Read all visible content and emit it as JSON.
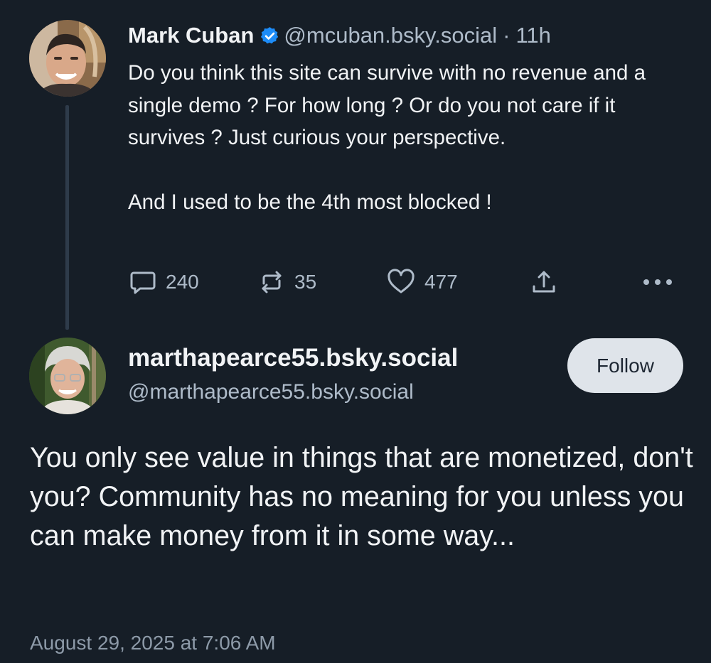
{
  "parent_post": {
    "author_name": "Mark Cuban",
    "verified": true,
    "handle": "@mcuban.bsky.social",
    "separator": "·",
    "time": "11h",
    "text_paragraphs": [
      "Do you think this site can survive with no revenue and a single demo ? For how long ? Or do you not care if it survives ? Just curious your perspective.",
      "And I used to be the 4th most blocked !"
    ],
    "actions": {
      "reply_count": "240",
      "repost_count": "35",
      "like_count": "477"
    }
  },
  "reply_post": {
    "display_name": "marthapearce55.bsky.social",
    "handle": "@marthapearce55.bsky.social",
    "follow_label": "Follow",
    "text": "You only see value in things that are monetized, don't you? Community has no meaning for you unless you can make money from it in some way...",
    "timestamp": "August 29, 2025 at 7:06 AM"
  },
  "icons": {
    "verified": "verified-badge-icon",
    "reply": "speech-bubble-icon",
    "repost": "repost-arrows-icon",
    "like": "heart-icon",
    "share": "share-upload-icon",
    "more": "more-dots-icon"
  },
  "colors": {
    "background": "#161e27",
    "text": "#f1f3f5",
    "muted": "#aebbc9",
    "verified_blue": "#1d8cf8",
    "follow_button_bg": "#dfe4ea",
    "thread_line": "#2e3b4a"
  }
}
